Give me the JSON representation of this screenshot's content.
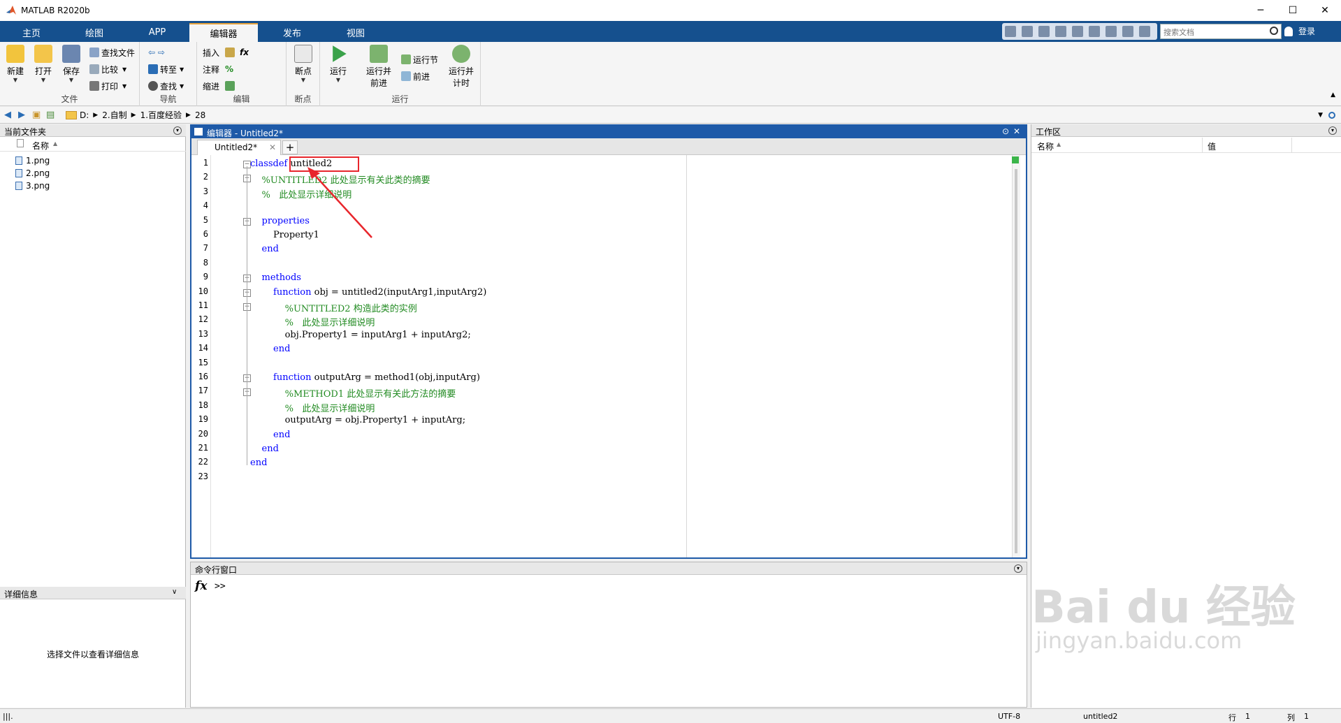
{
  "app": {
    "title": "MATLAB R2020b",
    "window_controls": {
      "minimize": "─",
      "maximize": "☐",
      "close": "✕"
    }
  },
  "tabs": [
    {
      "label": "主页"
    },
    {
      "label": "绘图"
    },
    {
      "label": "APP"
    },
    {
      "label": "编辑器"
    },
    {
      "label": "发布"
    },
    {
      "label": "视图"
    }
  ],
  "search": {
    "placeholder": "搜索文档"
  },
  "login": "登录",
  "ribbon": {
    "file": {
      "group": "文件",
      "new": "新建",
      "open": "打开",
      "save": "保存",
      "find_files": "查找文件",
      "compare": "比较",
      "print": "打印"
    },
    "navigate": {
      "group": "导航",
      "goto": "转至",
      "find": "查找"
    },
    "edit": {
      "group": "编辑",
      "insert": "插入",
      "comment": "注释",
      "indent": "缩进",
      "fx": "fx",
      "percent": "%"
    },
    "breakpoints": {
      "group": "断点",
      "label": "断点"
    },
    "run": {
      "group": "运行",
      "run": "运行",
      "run_advance": "运行并前进",
      "run_section": "运行节",
      "advance": "前进",
      "run_time": "运行并计时"
    }
  },
  "address": {
    "drive": "D:",
    "parts": [
      "2.自制",
      "1.百度经验",
      "28"
    ]
  },
  "left_panel": {
    "title": "当前文件夹",
    "column": "名称",
    "files": [
      "1.png",
      "2.png",
      "3.png"
    ],
    "details_title": "详细信息",
    "details_msg": "选择文件以查看详细信息"
  },
  "editor": {
    "title": "编辑器 - Untitled2*",
    "tab": "Untitled2*",
    "lines": [
      {
        "n": "1",
        "parts": [
          {
            "t": "classdef ",
            "c": "kw"
          },
          {
            "t": "untitled2",
            "c": ""
          }
        ]
      },
      {
        "n": "2",
        "parts": [
          {
            "t": "    %UNTITLED2 此处显示有关此类的摘要",
            "c": "cm"
          }
        ]
      },
      {
        "n": "3",
        "parts": [
          {
            "t": "    %   此处显示详细说明",
            "c": "cm"
          }
        ]
      },
      {
        "n": "4",
        "parts": []
      },
      {
        "n": "5",
        "parts": [
          {
            "t": "    properties",
            "c": "kw"
          }
        ]
      },
      {
        "n": "6",
        "parts": [
          {
            "t": "        Property1",
            "c": ""
          }
        ]
      },
      {
        "n": "7",
        "parts": [
          {
            "t": "    end",
            "c": "kw"
          }
        ]
      },
      {
        "n": "8",
        "parts": []
      },
      {
        "n": "9",
        "parts": [
          {
            "t": "    methods",
            "c": "kw"
          }
        ]
      },
      {
        "n": "10",
        "parts": [
          {
            "t": "        function",
            "c": "kw"
          },
          {
            "t": " obj = untitled2(inputArg1,inputArg2)",
            "c": ""
          }
        ]
      },
      {
        "n": "11",
        "parts": [
          {
            "t": "            %UNTITLED2 构造此类的实例",
            "c": "cm"
          }
        ]
      },
      {
        "n": "12",
        "parts": [
          {
            "t": "            %   此处显示详细说明",
            "c": "cm"
          }
        ]
      },
      {
        "n": "13",
        "parts": [
          {
            "t": "            obj.Property1 = inputArg1 + inputArg2;",
            "c": ""
          }
        ]
      },
      {
        "n": "14",
        "parts": [
          {
            "t": "        end",
            "c": "kw"
          }
        ]
      },
      {
        "n": "15",
        "parts": []
      },
      {
        "n": "16",
        "parts": [
          {
            "t": "        function",
            "c": "kw"
          },
          {
            "t": " outputArg = method1(obj,inputArg)",
            "c": ""
          }
        ]
      },
      {
        "n": "17",
        "parts": [
          {
            "t": "            %METHOD1 此处显示有关此方法的摘要",
            "c": "cm"
          }
        ]
      },
      {
        "n": "18",
        "parts": [
          {
            "t": "            %   此处显示详细说明",
            "c": "cm"
          }
        ]
      },
      {
        "n": "19",
        "parts": [
          {
            "t": "            outputArg = obj.Property1 + inputArg;",
            "c": ""
          }
        ]
      },
      {
        "n": "20",
        "parts": [
          {
            "t": "        end",
            "c": "kw"
          }
        ]
      },
      {
        "n": "21",
        "parts": [
          {
            "t": "    end",
            "c": "kw"
          }
        ]
      },
      {
        "n": "22",
        "parts": [
          {
            "t": "end",
            "c": "kw"
          }
        ]
      },
      {
        "n": "23",
        "parts": []
      }
    ]
  },
  "command_window": {
    "title": "命令行窗口",
    "fx": "fx",
    "prompt": ">>"
  },
  "workspace": {
    "title": "工作区",
    "col_name": "名称",
    "col_value": "值"
  },
  "status": {
    "encoding": "UTF-8",
    "file": "untitled2",
    "row_label": "行",
    "row": "1",
    "col_label": "列",
    "col": "1"
  },
  "watermark": {
    "brand": "Bai du 经验",
    "url": "jingyan.baidu.com"
  },
  "colors": {
    "tabbar": "#15508e",
    "accent": "#1e5aa8",
    "keyword": "#0000ff",
    "comment": "#228b22",
    "annotation": "#e8262c"
  }
}
